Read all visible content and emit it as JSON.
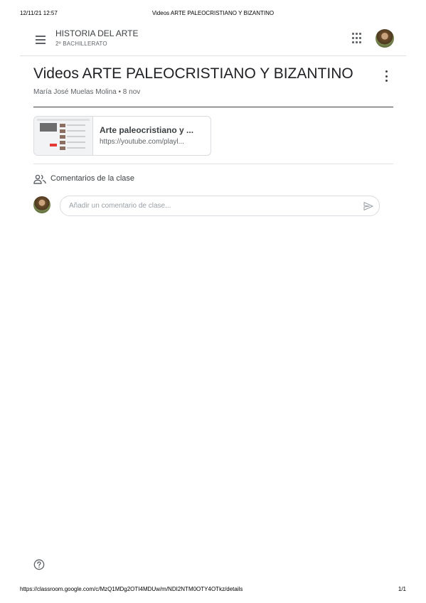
{
  "print": {
    "date": "12/11/21 12:57",
    "title": "Videos ARTE PALEOCRISTIANO Y BIZANTINO",
    "url": "https://classroom.google.com/c/MzQ1MDg2OTI4MDUw/m/NDI2NTM0OTY4OTkz/details",
    "page": "1/1"
  },
  "header": {
    "course_name": "HISTORIA DEL ARTE",
    "course_section": "2º BACHILLERATO",
    "menu_icon": "menu-icon",
    "apps_icon": "apps-grid-icon",
    "avatar_icon": "user-avatar"
  },
  "post": {
    "title": "Videos ARTE PALEOCRISTIANO Y BIZANTINO",
    "author": "María José Muelas Molina",
    "separator": "•",
    "date": "8 nov",
    "more_icon": "more-vert-icon"
  },
  "attachment": {
    "title": "Arte paleocristiano y ...",
    "url": "https://youtube.com/playl..."
  },
  "comments": {
    "label": "Comentarios de la clase",
    "icon": "people-icon",
    "placeholder": "Añadir un comentario de clase...",
    "send_icon": "send-icon"
  },
  "footer": {
    "help_icon": "help-icon"
  },
  "colors": {
    "text_primary": "#202124",
    "text_secondary": "#5f6368",
    "border": "#dadce0"
  }
}
